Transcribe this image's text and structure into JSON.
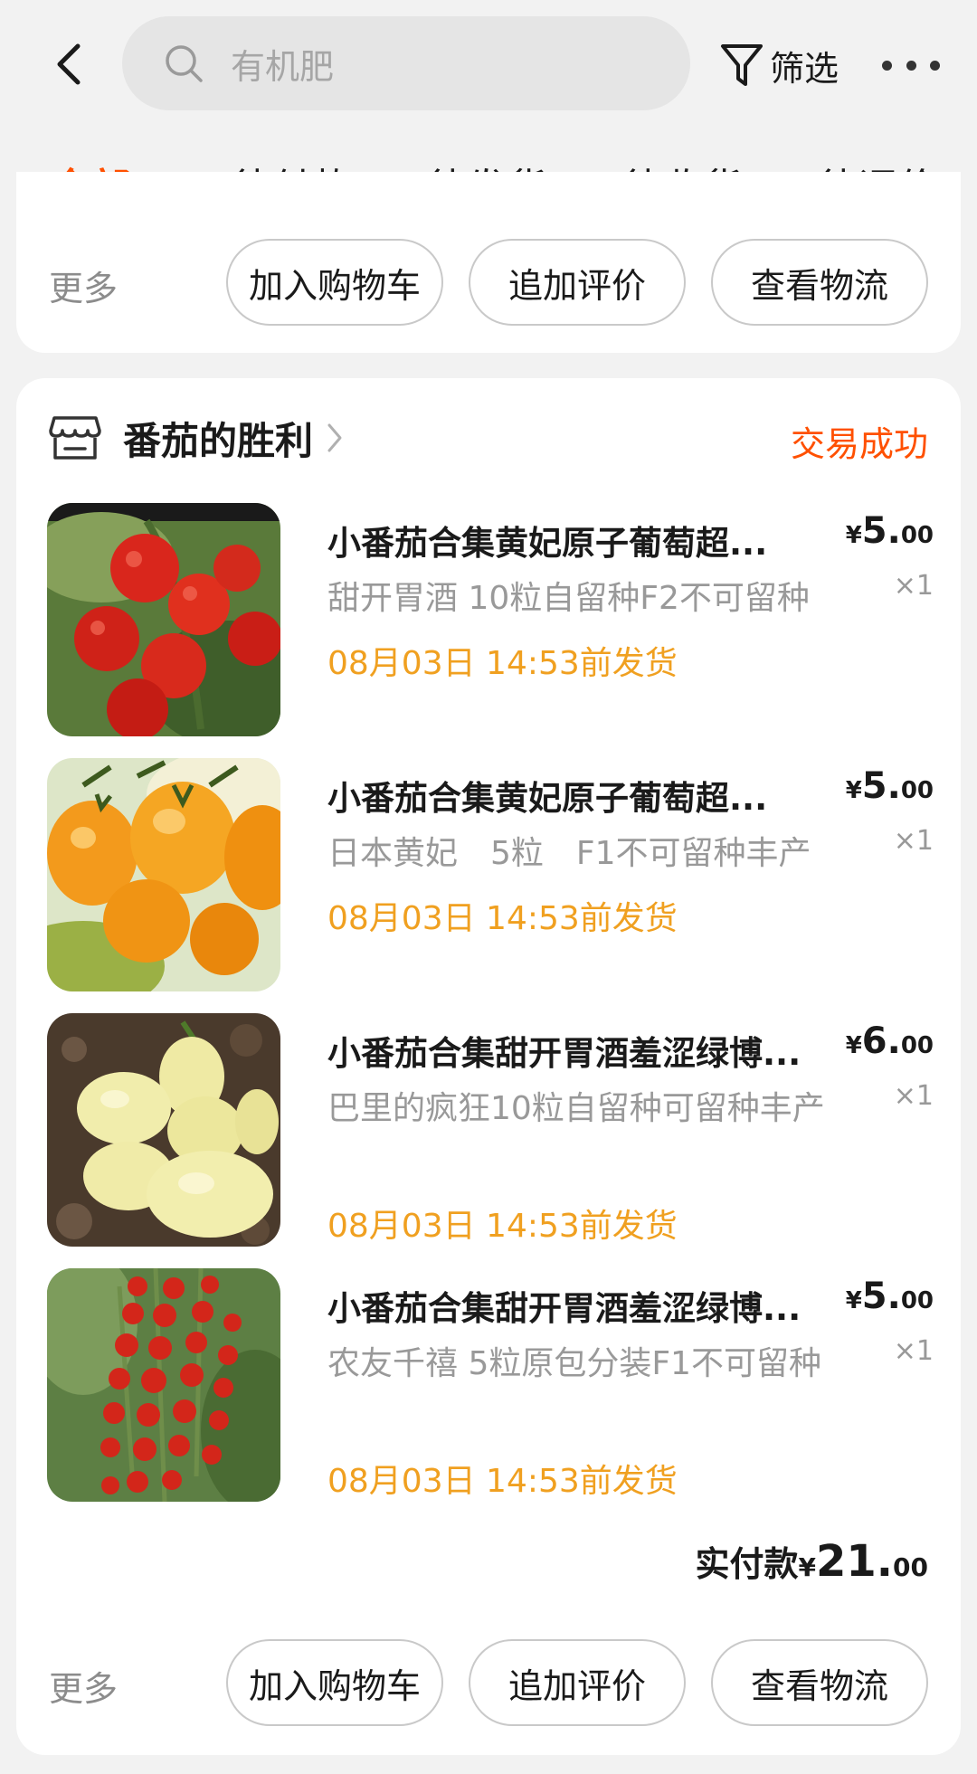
{
  "header": {
    "search_placeholder": "有机肥",
    "filter_label": "筛选"
  },
  "tabs": [
    {
      "label": "全部",
      "active": true
    },
    {
      "label": "待付款"
    },
    {
      "label": "待发货"
    },
    {
      "label": "待收货"
    },
    {
      "label": "待评价"
    }
  ],
  "prev_order": {
    "more_label": "更多",
    "buttons": [
      "加入购物车",
      "追加评价",
      "查看物流"
    ]
  },
  "order": {
    "shop_name": "番茄的胜利",
    "status": "交易成功",
    "items": [
      {
        "title": "小番茄合集黄妃原子葡萄超...",
        "spec": "甜开胃酒 10粒自留种F2不可留种",
        "ship": "08月03日 14:53前发货",
        "price_symbol": "¥",
        "price_int": "5.",
        "price_dec": "00",
        "qty": "×1",
        "image": "red-cherry-tomatoes"
      },
      {
        "title": "小番茄合集黄妃原子葡萄超...",
        "spec": "日本黄妃　5粒　F1不可留种丰产",
        "ship": "08月03日 14:53前发货",
        "price_symbol": "¥",
        "price_int": "5.",
        "price_dec": "00",
        "qty": "×1",
        "image": "orange-cherry-tomatoes"
      },
      {
        "title": "小番茄合集甜开胃酒羞涩绿博...",
        "spec": "巴里的疯狂10粒自留种可留种丰产",
        "ship": "08月03日 14:53前发货",
        "price_symbol": "¥",
        "price_int": "6.",
        "price_dec": "00",
        "qty": "×1",
        "image": "pale-yellow-tomatoes"
      },
      {
        "title": "小番茄合集甜开胃酒羞涩绿博...",
        "spec": "农友千禧 5粒原包分装F1不可留种",
        "ship": "08月03日 14:53前发货",
        "price_symbol": "¥",
        "price_int": "5.",
        "price_dec": "00",
        "qty": "×1",
        "image": "red-tomato-cluster"
      }
    ],
    "total_label": "实付款",
    "total_symbol": "¥",
    "total_int": "21.",
    "total_dec": "00",
    "more_label": "更多",
    "buttons": [
      "加入购物车",
      "追加评价",
      "查看物流"
    ]
  },
  "colors": {
    "accent": "#ff5000",
    "ship_text": "#f0a020",
    "background": "#f2f2f2"
  }
}
